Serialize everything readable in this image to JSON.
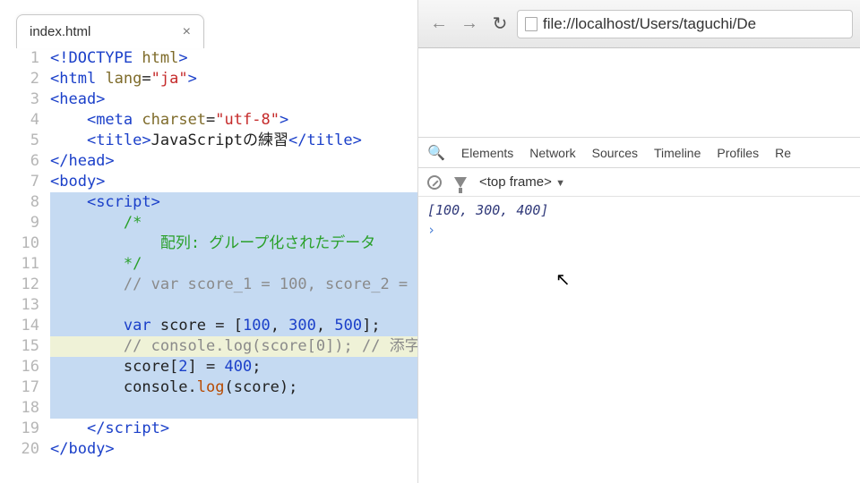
{
  "editor": {
    "tab_title": "index.html",
    "close_glyph": "×",
    "lines": [
      {
        "n": 1,
        "sel": false,
        "hl": false,
        "spans": [
          [
            "tag",
            "<!DOCTYPE"
          ],
          [
            "txt",
            " "
          ],
          [
            "attr",
            "html"
          ],
          [
            "tag",
            ">"
          ]
        ]
      },
      {
        "n": 2,
        "sel": false,
        "hl": false,
        "spans": [
          [
            "tag",
            "<html"
          ],
          [
            "txt",
            " "
          ],
          [
            "attr",
            "lang"
          ],
          [
            "txt",
            "="
          ],
          [
            "str",
            "\"ja\""
          ],
          [
            "tag",
            ">"
          ]
        ]
      },
      {
        "n": 3,
        "sel": false,
        "hl": false,
        "spans": [
          [
            "tag",
            "<head>"
          ]
        ]
      },
      {
        "n": 4,
        "sel": false,
        "hl": false,
        "spans": [
          [
            "txt",
            "    "
          ],
          [
            "tag",
            "<meta"
          ],
          [
            "txt",
            " "
          ],
          [
            "attr",
            "charset"
          ],
          [
            "txt",
            "="
          ],
          [
            "str",
            "\"utf-8\""
          ],
          [
            "tag",
            ">"
          ]
        ]
      },
      {
        "n": 5,
        "sel": false,
        "hl": false,
        "spans": [
          [
            "txt",
            "    "
          ],
          [
            "tag",
            "<title>"
          ],
          [
            "txt",
            "JavaScriptの練習"
          ],
          [
            "tag",
            "</title>"
          ]
        ]
      },
      {
        "n": 6,
        "sel": false,
        "hl": false,
        "spans": [
          [
            "tag",
            "</head>"
          ]
        ]
      },
      {
        "n": 7,
        "sel": false,
        "hl": false,
        "spans": [
          [
            "tag",
            "<body>"
          ]
        ]
      },
      {
        "n": 8,
        "sel": true,
        "hl": false,
        "spans": [
          [
            "txt",
            "    "
          ],
          [
            "tag",
            "<script>"
          ]
        ]
      },
      {
        "n": 9,
        "sel": true,
        "hl": false,
        "spans": [
          [
            "txt",
            "        "
          ],
          [
            "cmtg",
            "/*"
          ]
        ]
      },
      {
        "n": 10,
        "sel": true,
        "hl": false,
        "spans": [
          [
            "txt",
            "            "
          ],
          [
            "cmtg",
            "配列: グループ化されたデータ"
          ]
        ]
      },
      {
        "n": 11,
        "sel": true,
        "hl": false,
        "spans": [
          [
            "txt",
            "        "
          ],
          [
            "cmtg",
            "*/"
          ]
        ]
      },
      {
        "n": 12,
        "sel": true,
        "hl": false,
        "spans": [
          [
            "txt",
            "        "
          ],
          [
            "cmt",
            "// var score_1 = 100, score_2 ="
          ]
        ]
      },
      {
        "n": 13,
        "sel": true,
        "hl": false,
        "spans": [
          [
            "txt",
            " "
          ]
        ]
      },
      {
        "n": 14,
        "sel": true,
        "hl": false,
        "spans": [
          [
            "txt",
            "        "
          ],
          [
            "kw",
            "var"
          ],
          [
            "txt",
            " score = ["
          ],
          [
            "num",
            "100"
          ],
          [
            "txt",
            ", "
          ],
          [
            "num",
            "300"
          ],
          [
            "txt",
            ", "
          ],
          [
            "num",
            "500"
          ],
          [
            "txt",
            "];"
          ]
        ]
      },
      {
        "n": 15,
        "sel": true,
        "hl": true,
        "spans": [
          [
            "txt",
            "        "
          ],
          [
            "cmt",
            "// console.log(score[0]); // 添字"
          ]
        ]
      },
      {
        "n": 16,
        "sel": true,
        "hl": false,
        "spans": [
          [
            "txt",
            "        score["
          ],
          [
            "num",
            "2"
          ],
          [
            "txt",
            "] = "
          ],
          [
            "num",
            "400"
          ],
          [
            "txt",
            ";"
          ]
        ]
      },
      {
        "n": 17,
        "sel": true,
        "hl": false,
        "spans": [
          [
            "txt",
            "        console."
          ],
          [
            "fn",
            "log"
          ],
          [
            "txt",
            "(score);"
          ]
        ]
      },
      {
        "n": 18,
        "sel": true,
        "hl": false,
        "spans": [
          [
            "txt",
            " "
          ]
        ]
      },
      {
        "n": 19,
        "sel": false,
        "hl": false,
        "spans": [
          [
            "txt",
            "    "
          ],
          [
            "tag",
            "</script>"
          ]
        ]
      },
      {
        "n": 20,
        "sel": false,
        "hl": false,
        "spans": [
          [
            "tag",
            "</body>"
          ]
        ]
      }
    ]
  },
  "browser": {
    "back_glyph": "←",
    "fwd_glyph": "→",
    "reload_glyph": "↻",
    "url": "file://localhost/Users/taguchi/De",
    "devtools": {
      "tabs": [
        "Elements",
        "Network",
        "Sources",
        "Timeline",
        "Profiles",
        "Re"
      ],
      "frame_label": "<top frame>",
      "caret": "▼",
      "console_output": "[100, 300, 400]",
      "prompt_glyph": "›"
    }
  }
}
